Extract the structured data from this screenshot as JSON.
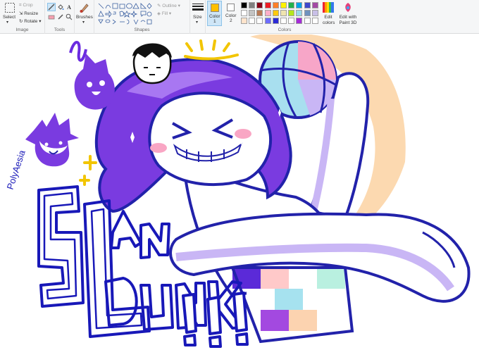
{
  "ribbon": {
    "image_group": {
      "label": "Image",
      "select": "Select",
      "crop": "Crop",
      "resize": "Resize",
      "rotate": "Rotate"
    },
    "tools_group": {
      "label": "Tools"
    },
    "brushes": {
      "label": "Brushes"
    },
    "shapes_group": {
      "label": "Shapes",
      "outline": "Outline",
      "fill": "Fill"
    },
    "size": {
      "label": "Size"
    },
    "colors_group": {
      "label": "Colors",
      "color1": {
        "label": "Color",
        "index": "1",
        "value": "#ffbf00"
      },
      "color2": {
        "label": "Color",
        "index": "2",
        "value": "#ffffff"
      },
      "edit_colors": "Edit colors",
      "paint3d": "Edit with Paint 3D",
      "palette_row1": [
        "#000000",
        "#7f7f7f",
        "#880015",
        "#ed1c24",
        "#ff7f27",
        "#fff200",
        "#22b14c",
        "#00a2e8",
        "#3f48cc",
        "#a349a4"
      ],
      "palette_row2": [
        "#ffffff",
        "#c3c3c3",
        "#b97a57",
        "#ffaec9",
        "#ffc90e",
        "#efe4b0",
        "#b5e61d",
        "#99d9ea",
        "#7092be",
        "#c8bfe7"
      ],
      "palette_row3": [
        "#ffe4cc",
        "#ffffff",
        "#ffffff",
        "#6c6cff",
        "#2b2bd6",
        "#ffffff",
        "#ffffff",
        "#a52ad8",
        "#ffffff",
        "#ffffff"
      ]
    }
  },
  "artwork": {
    "signature": "PolyAesia",
    "title_line1": "SLAM",
    "title_line2": "DUNK",
    "exclaim": "!!!"
  }
}
